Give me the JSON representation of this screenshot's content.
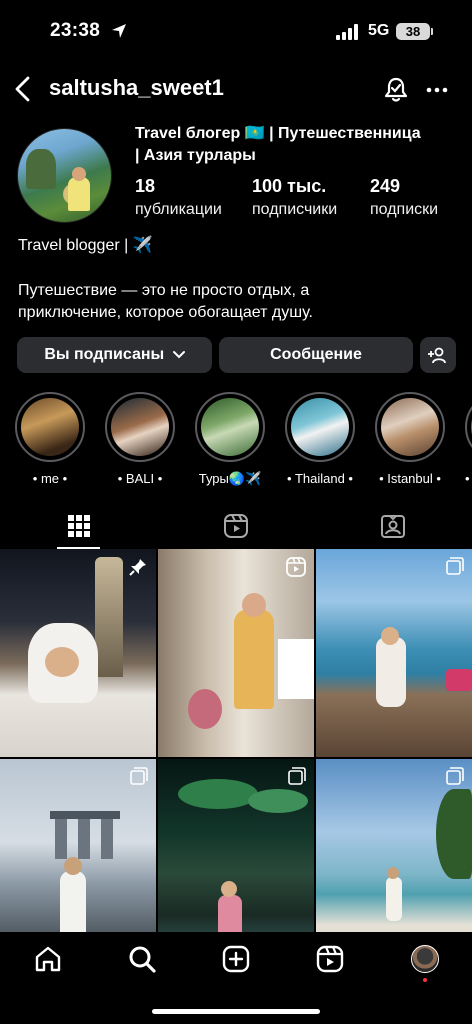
{
  "status": {
    "time": "23:38",
    "network": "5G",
    "battery": "38"
  },
  "header": {
    "username": "saltusha_sweet1"
  },
  "profile": {
    "bio_title_line1": "Travel блогер 🇰🇿 | Путешественница",
    "bio_title_line2": "| Азия турлары",
    "stats": [
      {
        "value": "18",
        "label": "публикации"
      },
      {
        "value": "100 тыс.",
        "label": "подписчики"
      },
      {
        "value": "249",
        "label": "подписки"
      }
    ],
    "bio_line1": "Travel blogger | ✈️",
    "bio_line2": "Путешествие — это не просто отдых, а",
    "bio_line3": "приключение, которое обогащает душу."
  },
  "actions": {
    "following_label": "Вы подписаны",
    "message_label": "Сообщение"
  },
  "highlights": [
    {
      "label": "• me •"
    },
    {
      "label": "• BALI •"
    },
    {
      "label": "Туры🌏✈️"
    },
    {
      "label": "• Thailand •"
    },
    {
      "label": "• Istanbul •"
    },
    {
      "label": "• S"
    }
  ],
  "tabs": [
    "grid-icon",
    "reels-icon",
    "tagged-icon"
  ],
  "posts": [
    {
      "type": "pinned",
      "icon": "pin-icon"
    },
    {
      "type": "reel",
      "icon": "reel-badge-icon"
    },
    {
      "type": "carousel",
      "icon": "carousel-icon"
    },
    {
      "type": "carousel",
      "icon": "carousel-icon"
    },
    {
      "type": "carousel",
      "icon": "carousel-icon"
    },
    {
      "type": "carousel",
      "icon": "carousel-icon"
    }
  ],
  "colors": {
    "background": "#000000",
    "button": "#2c2d31",
    "notification_dot": "#ff3040"
  }
}
